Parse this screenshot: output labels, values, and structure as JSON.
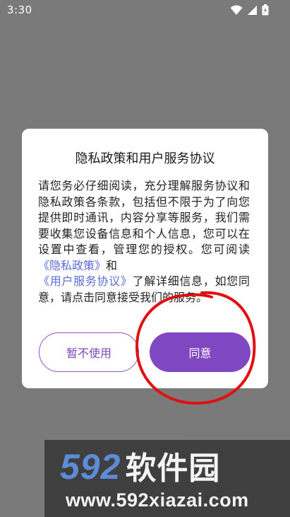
{
  "status_bar": {
    "time": "3:30",
    "icons": [
      "wifi-icon",
      "signal-icon",
      "battery-icon"
    ]
  },
  "dialog": {
    "title": "隐私政策和用户服务协议",
    "body": {
      "text_before_privacy": "请您务必仔细阅读，充分理解服务协议和隐私政策各条款，包括但不限于为了向您提供即时通讯，内容分享等服务，我们需要收集您设备信息和个人信息，您可以在设置中查看，管理您的授权。您可阅读",
      "privacy_link": "《隐私政策》",
      "and_text": "和",
      "terms_link": "《用户服务协议》",
      "text_after_links": "了解详细信息，如您同意，请点击同意接受我们的服务。"
    },
    "decline_label": "暂不使用",
    "agree_label": "同意"
  },
  "watermark": {
    "logo_number": "592",
    "logo_text": "软件园",
    "url": "www.592xiazai.com"
  },
  "colors": {
    "accent": "#8047c2",
    "link": "#5b6bd6",
    "overlay": "#7a7a7a",
    "annotation": "#e01010"
  }
}
